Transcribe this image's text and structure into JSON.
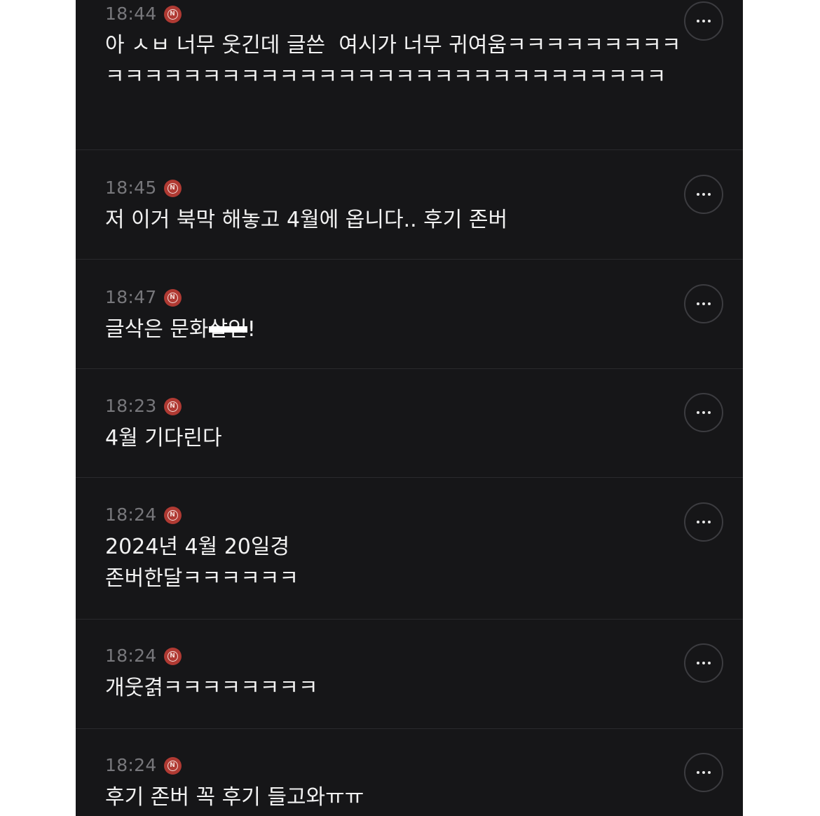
{
  "comments": [
    {
      "time": "18:44",
      "badge": "N",
      "text": "아 ㅅㅂ 너무 웃긴데 글쓴  여시가 너무 귀여움ㅋㅋㅋㅋㅋㅋㅋㅋㅋㅋㅋㅋㅋㅋㅋㅋㅋㅋㅋㅋㅋㅋㅋㅋㅋㅋㅋㅋㅋㅋㅋㅋㅋㅋㅋㅋㅋㅋ",
      "more_icon": "more-dots-icon"
    },
    {
      "time": "18:45",
      "badge": "N",
      "text": "저 이거 북막 해놓고 4월에 옵니다.. 후기 존버",
      "more_icon": "more-dots-icon"
    },
    {
      "time": "18:47",
      "badge": "N",
      "text_before": "글삭은 문화",
      "text_redacted": "살인",
      "text_after": "!",
      "more_icon": "more-dots-icon"
    },
    {
      "time": "18:23",
      "badge": "N",
      "text": "4월 기다린다",
      "more_icon": "more-dots-icon"
    },
    {
      "time": "18:24",
      "badge": "N",
      "text": "2024년 4월 20일경\n존버한달ㅋㅋㅋㅋㅋㅋ",
      "more_icon": "more-dots-icon"
    },
    {
      "time": "18:24",
      "badge": "N",
      "text": "개웃겱ㅋㅋㅋㅋㅋㅋㅋㅋ",
      "more_icon": "more-dots-icon"
    },
    {
      "time": "18:24",
      "badge": "N",
      "text": "후기 존버 꼭 후기 들고와ㅠㅠ",
      "more_icon": "more-dots-icon"
    }
  ],
  "colors": {
    "background": "#161618",
    "text": "#f2f2f2",
    "timestamp": "#77777b",
    "new_badge": "#b03a33",
    "divider": "#2a2a2d"
  }
}
